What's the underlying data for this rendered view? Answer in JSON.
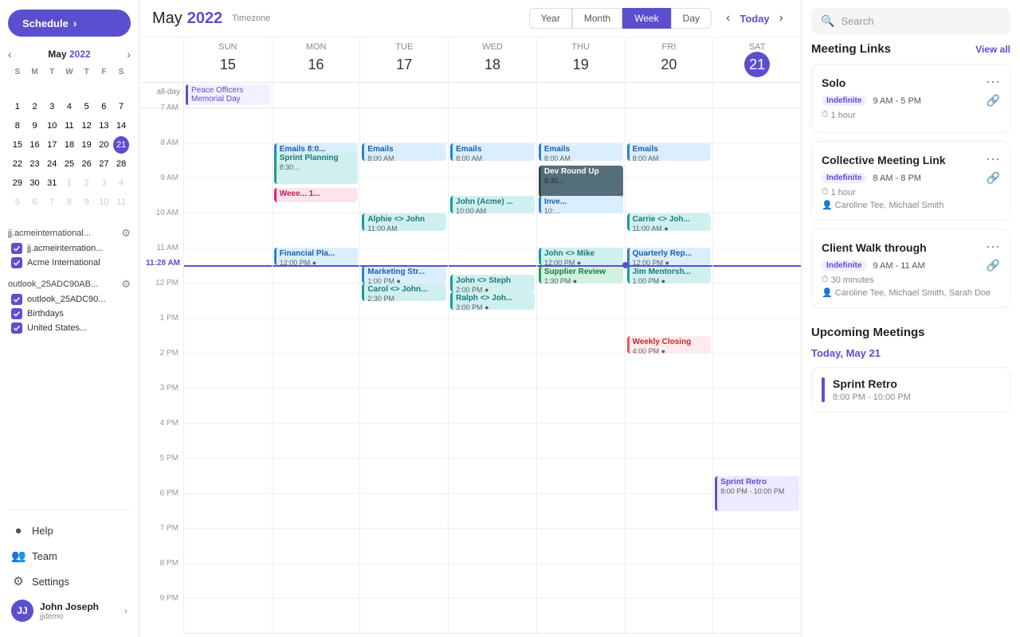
{
  "sidebar": {
    "schedule_btn": "Schedule",
    "mini_cal": {
      "month": "May",
      "year": "2022",
      "day_headers": [
        "S",
        "M",
        "T",
        "W",
        "T",
        "F",
        "S"
      ],
      "weeks": [
        [
          null,
          null,
          null,
          null,
          null,
          null,
          null
        ],
        [
          1,
          2,
          3,
          4,
          5,
          6,
          7
        ],
        [
          8,
          9,
          10,
          11,
          12,
          13,
          14
        ],
        [
          15,
          16,
          17,
          18,
          19,
          20,
          21
        ],
        [
          22,
          23,
          24,
          25,
          26,
          27,
          28
        ],
        [
          29,
          30,
          31,
          1,
          2,
          3,
          4
        ],
        [
          5,
          6,
          7,
          8,
          9,
          10,
          11
        ]
      ],
      "today": 21
    },
    "accounts": [
      {
        "name": "jj.acmeinternational...",
        "items": [
          "jj.acmeinternation...",
          "Acme International"
        ]
      },
      {
        "name": "outlook_25ADC90AB...",
        "items": [
          "outlook_25ADC90...",
          "Birthdays",
          "United States..."
        ]
      }
    ],
    "nav": [
      {
        "label": "Help",
        "icon": "?"
      },
      {
        "label": "Team",
        "icon": "👥"
      },
      {
        "label": "Settings",
        "icon": "⚙"
      }
    ],
    "user": {
      "name": "John Joseph",
      "email": "jjdemo",
      "initials": "JJ"
    }
  },
  "header": {
    "month": "May",
    "year": "2022",
    "timezone_label": "Timezone",
    "views": [
      "Year",
      "Month",
      "Week",
      "Day"
    ],
    "active_view": "Week",
    "today_label": "Today"
  },
  "week": {
    "days": [
      {
        "name": "Sun",
        "num": "15"
      },
      {
        "name": "Mon",
        "num": "16"
      },
      {
        "name": "Tue",
        "num": "17"
      },
      {
        "name": "Wed",
        "num": "18"
      },
      {
        "name": "Thu",
        "num": "19"
      },
      {
        "name": "Fri",
        "num": "20"
      },
      {
        "name": "Sat",
        "num": "21",
        "today": true
      }
    ],
    "allday_label": "all-day",
    "allday_events": [
      {
        "day": 0,
        "title": "Peace Officers Memorial Day",
        "color": "purple"
      }
    ],
    "time_slots": [
      "7 AM",
      "8 AM",
      "9 AM",
      "10 AM",
      "11 AM",
      "12 PM",
      "1 PM",
      "2 PM",
      "3 PM",
      "4 PM",
      "5 PM",
      "6 PM",
      "7 PM",
      "8 PM",
      "9 PM"
    ],
    "now_label": "11:28 AM"
  },
  "events": [
    {
      "day": 1,
      "title": "Emails 8:0...",
      "time": "8:00 AM",
      "color": "blue",
      "top_pct": 44,
      "height": 22
    },
    {
      "day": 1,
      "title": "Sprint Planning",
      "time": "8:30...",
      "color": "teal",
      "top_pct": 55,
      "height": 40
    },
    {
      "day": 1,
      "title": "Weee... 1...",
      "time": "",
      "color": "pink",
      "top_pct": 100,
      "height": 18
    },
    {
      "day": 1,
      "title": "Financial Pla...",
      "time": "12:00 PM ●",
      "color": "blue",
      "top_pct": 175,
      "height": 22
    },
    {
      "day": 2,
      "title": "Emails",
      "time": "8:00 AM",
      "color": "blue",
      "top_pct": 44,
      "height": 22
    },
    {
      "day": 2,
      "title": "Alphie <> John",
      "time": "11:00 AM",
      "color": "teal",
      "top_pct": 132,
      "height": 22
    },
    {
      "day": 2,
      "title": "Marketing Str...",
      "time": "1:00 PM ●",
      "color": "blue",
      "top_pct": 198,
      "height": 22
    },
    {
      "day": 2,
      "title": "Carol <> John...",
      "time": "2:30 PM",
      "color": "teal",
      "top_pct": 220,
      "height": 22
    },
    {
      "day": 3,
      "title": "Emails",
      "time": "8:00 AM",
      "color": "blue",
      "top_pct": 44,
      "height": 22
    },
    {
      "day": 3,
      "title": "John (Acme) ...",
      "time": "10:00 AM",
      "color": "teal",
      "top_pct": 110,
      "height": 22
    },
    {
      "day": 3,
      "title": "John <> Steph",
      "time": "2:00 PM ●",
      "color": "teal",
      "top_pct": 209,
      "height": 22
    },
    {
      "day": 3,
      "title": "Ralph <> Joh...",
      "time": "3:00 PM ●",
      "color": "teal",
      "top_pct": 231,
      "height": 22
    },
    {
      "day": 4,
      "title": "Emails",
      "time": "8:00 AM",
      "color": "blue",
      "top_pct": 44,
      "height": 22
    },
    {
      "day": 4,
      "title": "Dev Round Up",
      "time": "9:30...",
      "color": "dark",
      "top_pct": 72,
      "height": 40
    },
    {
      "day": 4,
      "title": "Inve...",
      "time": "10:...",
      "color": "blue",
      "top_pct": 110,
      "height": 22
    },
    {
      "day": 4,
      "title": "John <> Mike",
      "time": "12:00 PM ●",
      "color": "teal",
      "top_pct": 175,
      "height": 22
    },
    {
      "day": 4,
      "title": "Supplier Review",
      "time": "1:30 PM ●",
      "color": "green",
      "top_pct": 198,
      "height": 22
    },
    {
      "day": 5,
      "title": "Emails",
      "time": "8:00 AM",
      "color": "blue",
      "top_pct": 44,
      "height": 22
    },
    {
      "day": 5,
      "title": "Carrie <> Joh...",
      "time": "11:00 AM ●",
      "color": "teal",
      "top_pct": 132,
      "height": 22
    },
    {
      "day": 5,
      "title": "Quarterly Rep...",
      "time": "12:00 PM ●",
      "color": "blue",
      "top_pct": 175,
      "height": 22
    },
    {
      "day": 5,
      "title": "Jim Mentorsh...",
      "time": "1:00 PM ●",
      "color": "teal",
      "top_pct": 198,
      "height": 22
    },
    {
      "day": 5,
      "title": "Weekly Closing",
      "time": "4:00 PM ●",
      "color": "red",
      "top_pct": 286,
      "height": 22
    },
    {
      "day": 6,
      "title": "Sprint Retro",
      "time": "8:00 PM - 10:00 PM",
      "color": "purple",
      "top_pct": 462,
      "height": 44
    }
  ],
  "right_panel": {
    "search_placeholder": "Search",
    "meeting_links": {
      "title": "Meeting Links",
      "view_all": "View all",
      "cards": [
        {
          "title": "Solo",
          "badge": "Indefinite",
          "time": "9 AM - 5 PM",
          "duration": "1 hour",
          "attendees": null
        },
        {
          "title": "Collective Meeting Link",
          "badge": "Indefinite",
          "time": "8 AM - 8 PM",
          "duration": "1 hour",
          "attendees": "Caroline Tee, Michael Smith"
        },
        {
          "title": "Client Walk through",
          "badge": "Indefinite",
          "time": "9 AM - 11 AM",
          "duration": "30 minutes",
          "attendees": "Caroline Tee, Michael Smith, Sarah Doe"
        }
      ]
    },
    "upcoming": {
      "title": "Upcoming Meetings",
      "date_label": "Today, May 21",
      "meetings": [
        {
          "title": "Sprint Retro",
          "time": "8:00 PM - 10:00 PM"
        }
      ]
    }
  }
}
